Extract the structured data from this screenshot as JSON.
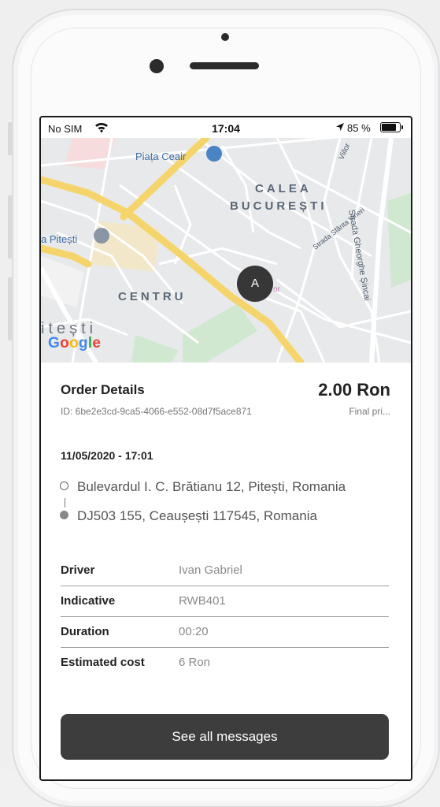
{
  "status_bar": {
    "carrier": "No SIM",
    "time": "17:04",
    "battery": "85 %"
  },
  "map": {
    "labels": {
      "piata_ceair": "Piața Ceair",
      "calea_1": "CALEA",
      "calea_2": "BUCUREȘTI",
      "pitesti_poi": "a Pitești",
      "centru": "CENTRU",
      "pitesti_city": "itești",
      "strada_sfanta_vineri": "Strada Sfânta Vineri",
      "strada_gheorghe_sincai": "Strada Gheorghe Șincai",
      "viilor": "Viilor",
      "partial_or": "or"
    },
    "google_logo": "Google",
    "marker_label": "A"
  },
  "order": {
    "title": "Order Details",
    "price": "2.00 Ron",
    "id": "ID: 6be2e3cd-9ca5-4066-e552-08d7f5ace871",
    "price_note": "Final pri...",
    "date": "11/05/2020 - 17:01",
    "pickup": "Bulevardul I. C. Brătianu 12, Pitești, Romania",
    "dropoff": "DJ503 155, Ceaușești 117545, Romania"
  },
  "details": [
    {
      "label": "Driver",
      "value": "Ivan Gabriel"
    },
    {
      "label": "Indicative",
      "value": "RWB401"
    },
    {
      "label": "Duration",
      "value": "00:20"
    },
    {
      "label": "Estimated cost",
      "value": "6 Ron"
    }
  ],
  "actions": {
    "see_all_messages": "See all messages"
  },
  "colors": {
    "button": "#3d3d3d",
    "marker": "#373737",
    "map_road_major": "#f5d56b"
  }
}
